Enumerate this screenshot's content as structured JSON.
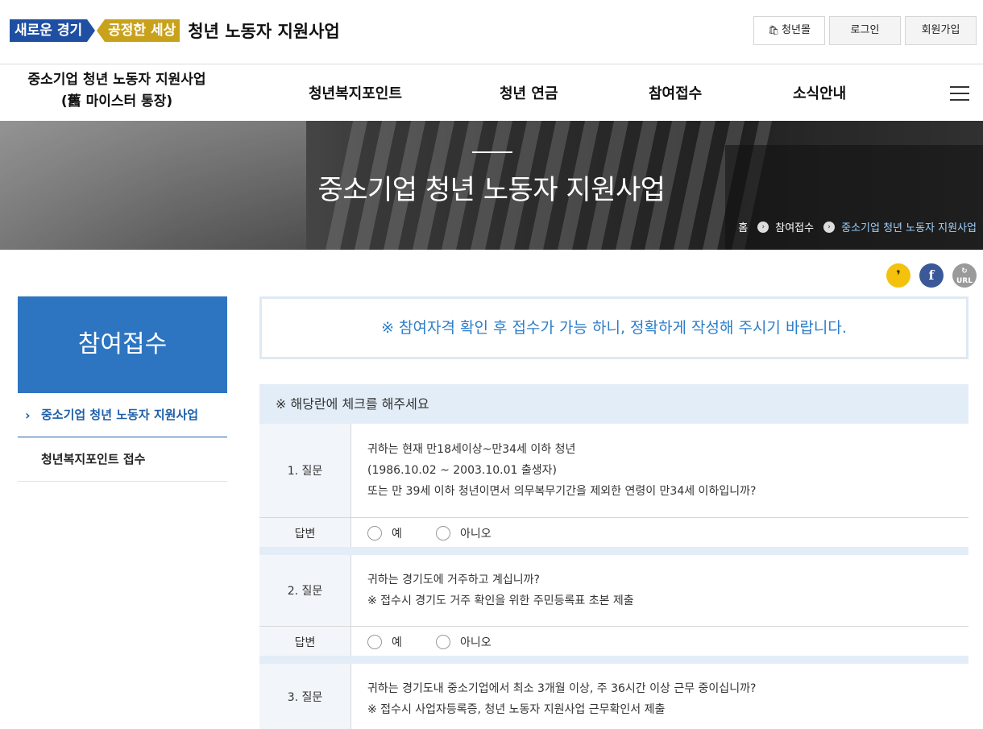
{
  "header": {
    "logo_part1": "새로운 경기",
    "logo_part2": "공정한 세상",
    "site_title": "청년 노동자 지원사업",
    "util": {
      "youth_mall": "청년몰",
      "login": "로그인",
      "signup": "회원가입"
    }
  },
  "nav": {
    "brand_line1": "중소기업 청년 노동자 지원사업",
    "brand_line2": "(舊 마이스터 통장)",
    "items": [
      "청년복지포인트",
      "청년 연금",
      "참여접수",
      "소식안내"
    ]
  },
  "banner": {
    "title": "중소기업 청년 노동자 지원사업",
    "breadcrumb": [
      "홈",
      "참여접수",
      "중소기업 청년 노동자 지원사업"
    ]
  },
  "share": {
    "url_label": "URL"
  },
  "sidebar": {
    "heading": "참여접수",
    "items": [
      "중소기업 청년 노동자 지원사업",
      "청년복지포인트 접수"
    ]
  },
  "notice": "※ 참여자격 확인 후 접수가 가능 하니, 정확하게 작성해 주시기 바랍니다.",
  "checklist": {
    "heading": "※ 해당란에 체크를 해주세요",
    "answer_label": "답변",
    "options": [
      "예",
      "아니오"
    ],
    "questions": [
      {
        "label": "1. 질문",
        "lines": [
          "귀하는 현재 만18세이상~만34세 이하 청년",
          "(1986.10.02 ~ 2003.10.01 출생자)",
          "또는 만 39세 이하 청년이면서 의무복무기간을 제외한 연령이 만34세 이하입니까?"
        ]
      },
      {
        "label": "2. 질문",
        "lines": [
          "귀하는 경기도에 거주하고 계십니까?",
          "※ 접수시 경기도 거주 확인을 위한 주민등록표 초본 제출"
        ]
      },
      {
        "label": "3. 질문",
        "lines": [
          "귀하는 경기도내 중소기업에서 최소 3개월 이상, 주 36시간 이상 근무 중이십니까?",
          "※ 접수시 사업자등록증, 청년 노동자 지원사업 근무확인서 제출"
        ]
      }
    ]
  }
}
